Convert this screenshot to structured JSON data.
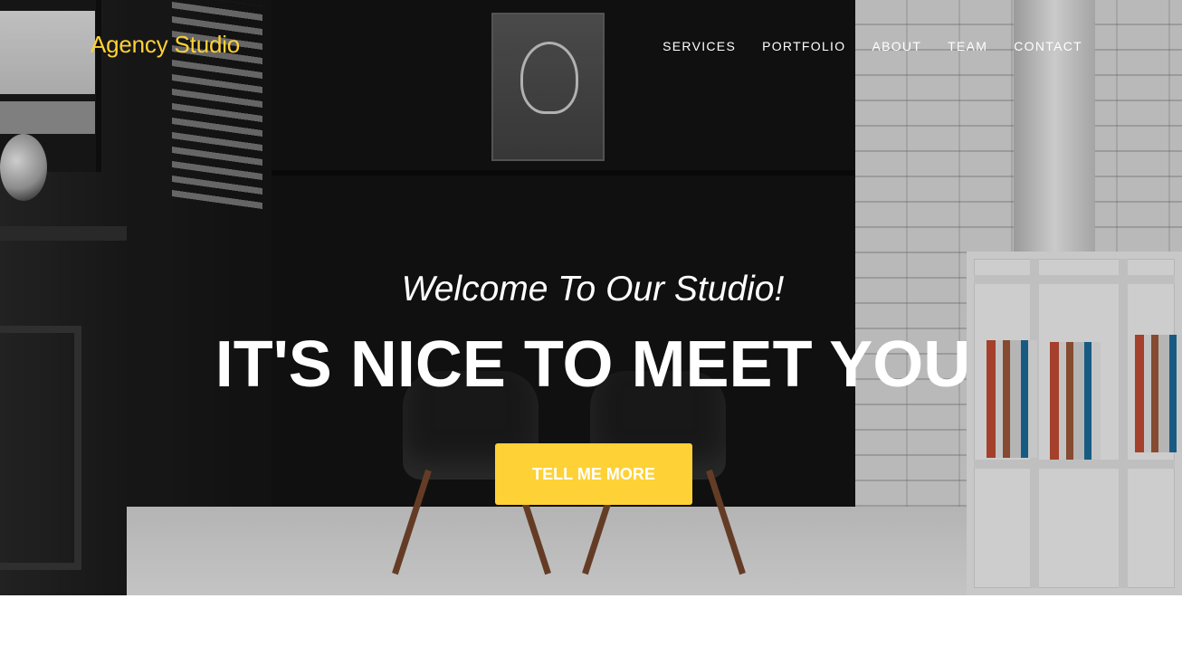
{
  "brand": {
    "name": "Agency Studio",
    "color": "#fed136"
  },
  "nav": {
    "items": [
      {
        "label": "SERVICES"
      },
      {
        "label": "PORTFOLIO"
      },
      {
        "label": "ABOUT"
      },
      {
        "label": "TEAM"
      },
      {
        "label": "CONTACT"
      }
    ]
  },
  "hero": {
    "lead": "Welcome To Our Studio!",
    "heading": "IT'S NICE TO MEET YOU",
    "cta_label": "TELL ME MORE",
    "accent_color": "#fed136"
  }
}
